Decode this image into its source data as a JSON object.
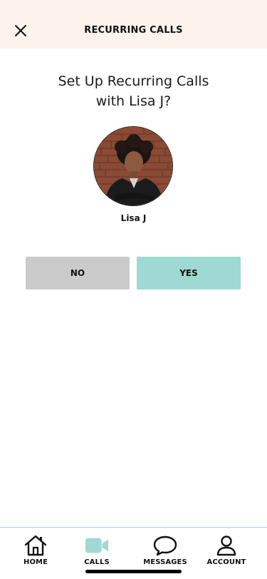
{
  "header": {
    "title": "RECURRING CALLS",
    "close_icon": "close-icon",
    "background": "#fdf3ec"
  },
  "prompt": {
    "line1": "Set Up Recurring Calls",
    "line2": "with Lisa J?"
  },
  "contact": {
    "name": "Lisa J",
    "avatar_icon": "profile-photo"
  },
  "actions": {
    "no_label": "NO",
    "yes_label": "YES",
    "no_color": "#cbcbcb",
    "yes_color": "#9fd9d3"
  },
  "tabbar": {
    "items": [
      {
        "label": "HOME",
        "icon": "home-icon"
      },
      {
        "label": "CALLS",
        "icon": "video-camera-icon",
        "active": true
      },
      {
        "label": "MESSAGES",
        "icon": "chat-bubble-icon"
      },
      {
        "label": "ACCOUNT",
        "icon": "person-icon"
      }
    ],
    "accent": "#9fd9d3"
  }
}
